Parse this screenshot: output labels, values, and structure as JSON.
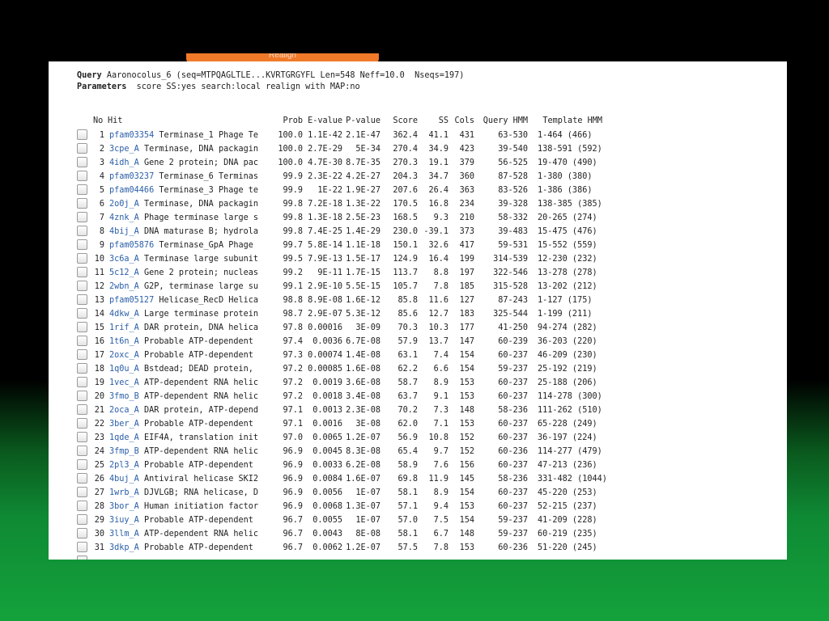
{
  "tab_text": "Realign",
  "query": {
    "label": "Query",
    "text": "Aaronocolus_6 (seq=MTPQAGLTLE...KVRTGRGYFL Len=548 Neff=10.0  Nseqs=197)"
  },
  "parameters": {
    "label": "Parameters",
    "text": "score SS:yes search:local realign with MAP:no"
  },
  "columns": {
    "no": "No",
    "hit": "Hit",
    "prob": "Prob",
    "evalue": "E-value",
    "pvalue": "P-value",
    "score": "Score",
    "ss": "SS",
    "cols": "Cols",
    "query_hmm": "Query HMM",
    "template_hmm": "Template HMM"
  },
  "rows": [
    {
      "no": "1",
      "id": "pfam03354",
      "desc": "Terminase_1 Phage Te",
      "prob": "100.0",
      "evalue": "1.1E-42",
      "pvalue": "2.1E-47",
      "score": "362.4",
      "ss": "41.1",
      "cols": "431",
      "query": "63-530",
      "template": "1-464 (466)"
    },
    {
      "no": "2",
      "id": "3cpe_A",
      "desc": "Terminase, DNA packagin",
      "prob": "100.0",
      "evalue": "2.7E-29",
      "pvalue": "5E-34",
      "score": "270.4",
      "ss": "34.9",
      "cols": "423",
      "query": "39-540",
      "template": "138-591 (592)"
    },
    {
      "no": "3",
      "id": "4idh_A",
      "desc": "Gene 2 protein; DNA pac",
      "prob": "100.0",
      "evalue": "4.7E-30",
      "pvalue": "8.7E-35",
      "score": "270.3",
      "ss": "19.1",
      "cols": "379",
      "query": "56-525",
      "template": "19-470 (490)"
    },
    {
      "no": "4",
      "id": "pfam03237",
      "desc": "Terminase_6 Terminas",
      "prob": "99.9",
      "evalue": "2.3E-22",
      "pvalue": "4.2E-27",
      "score": "204.3",
      "ss": "34.7",
      "cols": "360",
      "query": "87-528",
      "template": "1-380 (380)"
    },
    {
      "no": "5",
      "id": "pfam04466",
      "desc": "Terminase_3 Phage te",
      "prob": "99.9",
      "evalue": "1E-22",
      "pvalue": "1.9E-27",
      "score": "207.6",
      "ss": "26.4",
      "cols": "363",
      "query": "83-526",
      "template": "1-386 (386)"
    },
    {
      "no": "6",
      "id": "2o0j_A",
      "desc": "Terminase, DNA packagin",
      "prob": "99.8",
      "evalue": "7.2E-18",
      "pvalue": "1.3E-22",
      "score": "170.5",
      "ss": "16.8",
      "cols": "234",
      "query": "39-328",
      "template": "138-385 (385)"
    },
    {
      "no": "7",
      "id": "4znk_A",
      "desc": "Phage terminase large s",
      "prob": "99.8",
      "evalue": "1.3E-18",
      "pvalue": "2.5E-23",
      "score": "168.5",
      "ss": "9.3",
      "cols": "210",
      "query": "58-332",
      "template": "20-265 (274)"
    },
    {
      "no": "8",
      "id": "4bij_A",
      "desc": "DNA maturase B; hydrola",
      "prob": "99.8",
      "evalue": "7.4E-25",
      "pvalue": "1.4E-29",
      "score": "230.0",
      "ss": "-39.1",
      "cols": "373",
      "query": "39-483",
      "template": "15-475 (476)"
    },
    {
      "no": "9",
      "id": "pfam05876",
      "desc": "Terminase_GpA Phage",
      "prob": "99.7",
      "evalue": "5.8E-14",
      "pvalue": "1.1E-18",
      "score": "150.1",
      "ss": "32.6",
      "cols": "417",
      "query": "59-531",
      "template": "15-552 (559)"
    },
    {
      "no": "10",
      "id": "3c6a_A",
      "desc": "Terminase large subunit",
      "prob": "99.5",
      "evalue": "7.9E-13",
      "pvalue": "1.5E-17",
      "score": "124.9",
      "ss": "16.4",
      "cols": "199",
      "query": "314-539",
      "template": "12-230 (232)"
    },
    {
      "no": "11",
      "id": "5c12_A",
      "desc": "Gene 2 protein; nucleas",
      "prob": "99.2",
      "evalue": "9E-11",
      "pvalue": "1.7E-15",
      "score": "113.7",
      "ss": "8.8",
      "cols": "197",
      "query": "322-546",
      "template": "13-278 (278)"
    },
    {
      "no": "12",
      "id": "2wbn_A",
      "desc": "G2P, terminase large su",
      "prob": "99.1",
      "evalue": "2.9E-10",
      "pvalue": "5.5E-15",
      "score": "105.7",
      "ss": "7.8",
      "cols": "185",
      "query": "315-528",
      "template": "13-202 (212)"
    },
    {
      "no": "13",
      "id": "pfam05127",
      "desc": "Helicase_RecD Helica",
      "prob": "98.8",
      "evalue": "8.9E-08",
      "pvalue": "1.6E-12",
      "score": "85.8",
      "ss": "11.6",
      "cols": "127",
      "query": "87-243",
      "template": "1-127 (175)"
    },
    {
      "no": "14",
      "id": "4dkw_A",
      "desc": "Large terminase protein",
      "prob": "98.7",
      "evalue": "2.9E-07",
      "pvalue": "5.3E-12",
      "score": "85.6",
      "ss": "12.7",
      "cols": "183",
      "query": "325-544",
      "template": "1-199 (211)"
    },
    {
      "no": "15",
      "id": "1rif_A",
      "desc": "DAR protein, DNA helica",
      "prob": "97.8",
      "evalue": "0.00016",
      "pvalue": "3E-09",
      "score": "70.3",
      "ss": "10.3",
      "cols": "177",
      "query": "41-250",
      "template": "94-274 (282)"
    },
    {
      "no": "16",
      "id": "1t6n_A",
      "desc": "Probable ATP-dependent",
      "prob": "97.4",
      "evalue": "0.0036",
      "pvalue": "6.7E-08",
      "score": "57.9",
      "ss": "13.7",
      "cols": "147",
      "query": "60-239",
      "template": "36-203 (220)"
    },
    {
      "no": "17",
      "id": "2oxc_A",
      "desc": "Probable ATP-dependent",
      "prob": "97.3",
      "evalue": "0.00074",
      "pvalue": "1.4E-08",
      "score": "63.1",
      "ss": "7.4",
      "cols": "154",
      "query": "60-237",
      "template": "46-209 (230)"
    },
    {
      "no": "18",
      "id": "1q0u_A",
      "desc": "Bstdead; DEAD protein,",
      "prob": "97.2",
      "evalue": "0.00085",
      "pvalue": "1.6E-08",
      "score": "62.2",
      "ss": "6.6",
      "cols": "154",
      "query": "59-237",
      "template": "25-192 (219)"
    },
    {
      "no": "19",
      "id": "1vec_A",
      "desc": "ATP-dependent RNA helic",
      "prob": "97.2",
      "evalue": "0.0019",
      "pvalue": "3.6E-08",
      "score": "58.7",
      "ss": "8.9",
      "cols": "153",
      "query": "60-237",
      "template": "25-188 (206)"
    },
    {
      "no": "20",
      "id": "3fmo_B",
      "desc": "ATP-dependent RNA helic",
      "prob": "97.2",
      "evalue": "0.0018",
      "pvalue": "3.4E-08",
      "score": "63.7",
      "ss": "9.1",
      "cols": "153",
      "query": "60-237",
      "template": "114-278 (300)"
    },
    {
      "no": "21",
      "id": "2oca_A",
      "desc": "DAR protein, ATP-depend",
      "prob": "97.1",
      "evalue": "0.0013",
      "pvalue": "2.3E-08",
      "score": "70.2",
      "ss": "7.3",
      "cols": "148",
      "query": "58-236",
      "template": "111-262 (510)"
    },
    {
      "no": "22",
      "id": "3ber_A",
      "desc": "Probable ATP-dependent",
      "prob": "97.1",
      "evalue": "0.0016",
      "pvalue": "3E-08",
      "score": "62.0",
      "ss": "7.1",
      "cols": "153",
      "query": "60-237",
      "template": "65-228 (249)"
    },
    {
      "no": "23",
      "id": "1qde_A",
      "desc": "EIF4A, translation init",
      "prob": "97.0",
      "evalue": "0.0065",
      "pvalue": "1.2E-07",
      "score": "56.9",
      "ss": "10.8",
      "cols": "152",
      "query": "60-237",
      "template": "36-197 (224)"
    },
    {
      "no": "24",
      "id": "3fmp_B",
      "desc": "ATP-dependent RNA helic",
      "prob": "96.9",
      "evalue": "0.0045",
      "pvalue": "8.3E-08",
      "score": "65.4",
      "ss": "9.7",
      "cols": "152",
      "query": "60-236",
      "template": "114-277 (479)"
    },
    {
      "no": "25",
      "id": "2pl3_A",
      "desc": "Probable ATP-dependent",
      "prob": "96.9",
      "evalue": "0.0033",
      "pvalue": "6.2E-08",
      "score": "58.9",
      "ss": "7.6",
      "cols": "156",
      "query": "60-237",
      "template": "47-213 (236)"
    },
    {
      "no": "26",
      "id": "4buj_A",
      "desc": "Antiviral helicase SKI2",
      "prob": "96.9",
      "evalue": "0.0084",
      "pvalue": "1.6E-07",
      "score": "69.8",
      "ss": "11.9",
      "cols": "145",
      "query": "58-236",
      "template": "331-482 (1044)"
    },
    {
      "no": "27",
      "id": "1wrb_A",
      "desc": "DJVLGB; RNA helicase, D",
      "prob": "96.9",
      "evalue": "0.0056",
      "pvalue": "1E-07",
      "score": "58.1",
      "ss": "8.9",
      "cols": "154",
      "query": "60-237",
      "template": "45-220 (253)"
    },
    {
      "no": "28",
      "id": "3bor_A",
      "desc": "Human initiation factor",
      "prob": "96.9",
      "evalue": "0.0068",
      "pvalue": "1.3E-07",
      "score": "57.1",
      "ss": "9.4",
      "cols": "153",
      "query": "60-237",
      "template": "52-215 (237)"
    },
    {
      "no": "29",
      "id": "3iuy_A",
      "desc": "Probable ATP-dependent",
      "prob": "96.7",
      "evalue": "0.0055",
      "pvalue": "1E-07",
      "score": "57.0",
      "ss": "7.5",
      "cols": "154",
      "query": "59-237",
      "template": "41-209 (228)"
    },
    {
      "no": "30",
      "id": "3llm_A",
      "desc": "ATP-dependent RNA helic",
      "prob": "96.7",
      "evalue": "0.0043",
      "pvalue": "8E-08",
      "score": "58.1",
      "ss": "6.7",
      "cols": "148",
      "query": "59-237",
      "template": "60-219 (235)"
    },
    {
      "no": "31",
      "id": "3dkp_A",
      "desc": "Probable ATP-dependent",
      "prob": "96.7",
      "evalue": "0.0062",
      "pvalue": "1.2E-07",
      "score": "57.5",
      "ss": "7.8",
      "cols": "153",
      "query": "60-236",
      "template": "51-220 (245)"
    }
  ]
}
